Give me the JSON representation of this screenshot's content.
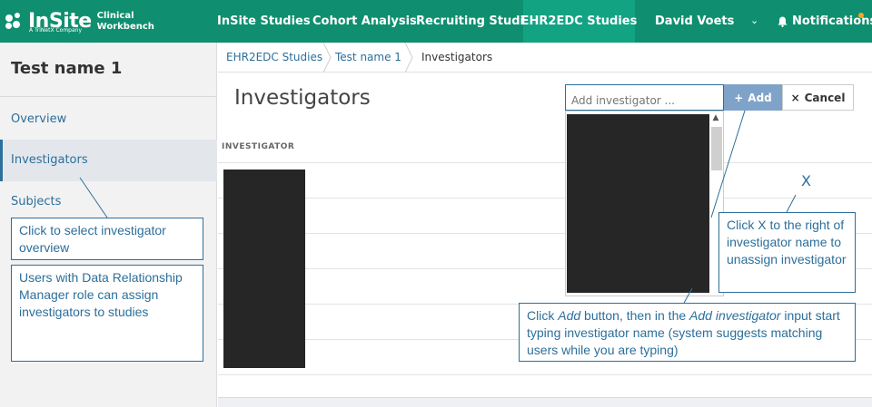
{
  "colors": {
    "brand": "#0f8f6f",
    "link": "#2c6f9b",
    "add_button": "#7fa3c8",
    "notification_dot": "#f5a623"
  },
  "logo": {
    "name": "InSite",
    "tagline": "A TriNetX Company",
    "product_line1": "Clinical",
    "product_line2": "Workbench"
  },
  "nav": {
    "items": [
      {
        "label": "InSite Studies"
      },
      {
        "label": "Cohort Analysis"
      },
      {
        "label": "Recruiting Studies"
      },
      {
        "label": "EHR2EDC Studies",
        "active": true
      },
      {
        "label": "David Voets"
      }
    ],
    "user_menu_icon": "chevron-down-icon",
    "notifications_icon": "bell-icon",
    "notifications_label": "Notifications"
  },
  "sidebar": {
    "title": "Test name 1",
    "items": [
      {
        "label": "Overview"
      },
      {
        "label": "Investigators",
        "active": true
      },
      {
        "label": "Subjects"
      }
    ]
  },
  "breadcrumb": {
    "items": [
      "EHR2EDC Studies",
      "Test name 1",
      "Investigators"
    ]
  },
  "main": {
    "title": "Investigators",
    "add_input_placeholder": "Add investigator ...",
    "add_button_label": "Add",
    "add_button_icon": "plus-icon",
    "cancel_button_label": "Cancel",
    "cancel_button_icon": "close-icon",
    "column_header": "INVESTIGATOR",
    "remove_mark": "X"
  },
  "callouts": {
    "select_overview": "Click to select investigator overview",
    "assign_info": "Users with Data Relationship Manager role can assign investigators to studies",
    "unassign": "Click X to the right of investigator name to unassign investigator",
    "add_click": "Click ",
    "add_word": "Add",
    "add_mid": " button, then in the ",
    "add_input_word": "Add investigator",
    "add_rest": " input start typing investigator name (system suggests matching users while you are typing)"
  }
}
